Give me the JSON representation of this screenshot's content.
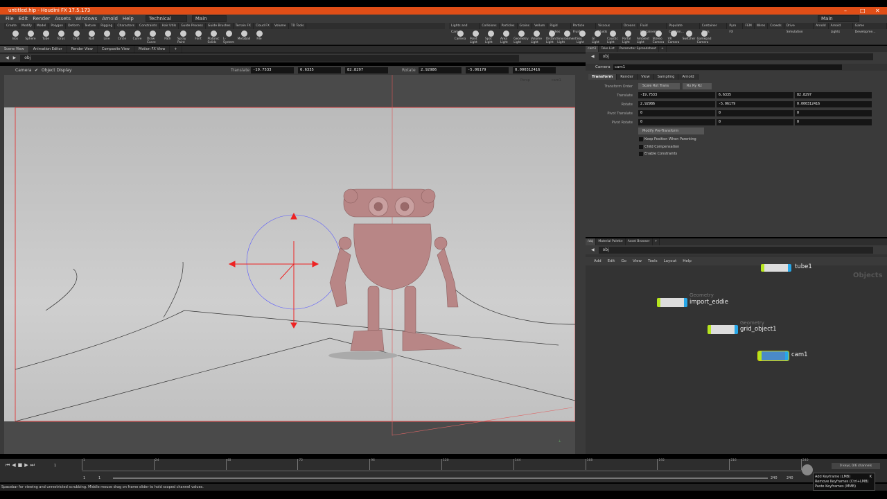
{
  "window": {
    "title": "untitled.hip - Houdini FX 17.5.173"
  },
  "menu": [
    "File",
    "Edit",
    "Render",
    "Assets",
    "Windows",
    "Arnold",
    "Help"
  ],
  "desktop": "Technical",
  "desktop2": "Main",
  "desktop_right": "Main",
  "shelf_tabs_left": [
    "Create",
    "Modify",
    "Model",
    "Polygon",
    "Deform",
    "Texture",
    "Rigging",
    "Characters",
    "Constraints",
    "Hair Utils",
    "Guide Process",
    "Guide Brushes",
    "Terrain FX",
    "Cloud FX",
    "Volume",
    "TD Tools"
  ],
  "shelf_tools_left": [
    "Box",
    "Sphere",
    "Tube",
    "Torus",
    "Grid",
    "Null",
    "Line",
    "Circle",
    "Curve",
    "Draw Curve",
    "Path",
    "Spray Paint",
    "Font",
    "Platonic Solids",
    "L-System",
    "Metaball",
    "File"
  ],
  "shelf_tabs_right": [
    "Lights and Cam...",
    "Collisions",
    "Particles",
    "Grains",
    "Vellum",
    "Rigid Bodies",
    "Particle Fluids",
    "Viscous Fluids",
    "Oceans",
    "Fluid Containers",
    "Populate Contain...",
    "Container Tools",
    "Pyro FX",
    "FEM",
    "Wires",
    "Crowds",
    "Drive Simulation",
    "Arnold",
    "Arnold Lights",
    "Game Developme..."
  ],
  "shelf_tools_right": [
    "Camera",
    "Point Light",
    "Spot Light",
    "Area Light",
    "Geometry Light",
    "Volume Light",
    "Distant Light",
    "Environment Light",
    "Sky Light",
    "GI Light",
    "Caustic Light",
    "Portal Light",
    "Ambient Light",
    "Stereo Camera",
    "VR Camera",
    "Switcher",
    "Gamepad Camera"
  ],
  "viewer": {
    "tabs": [
      "Scene View",
      "Animation Editor",
      "Render View",
      "Composite View",
      "Motion FX View"
    ],
    "path": "obj",
    "tool": "Camera",
    "object_display": "Object Display",
    "translate_label": "Translate",
    "translate": [
      "-19.7533",
      "6.6335",
      "82.8297"
    ],
    "rotate_label": "Rotate",
    "rotate": [
      "2.92986",
      "-5.06179",
      "0.000312416"
    ],
    "persp": "Persp",
    "cam": "cam1"
  },
  "params": {
    "tabs": [
      "cam1",
      "Take List",
      "Parameter Spreadsheet"
    ],
    "path": "obj",
    "node_type": "Camera",
    "node_name": "cam1",
    "subtabs": [
      "Transform",
      "Render",
      "View",
      "Sampling",
      "Arnold"
    ],
    "transform_order_label": "Transform Order",
    "transform_order": "Scale Rot Trans",
    "rot_order": "Rx Ry Rz",
    "rows": [
      {
        "label": "Translate",
        "values": [
          "-19.7533",
          "6.6335",
          "82.8297"
        ]
      },
      {
        "label": "Rotate",
        "values": [
          "2.92986",
          "-5.06179",
          "0.000312416"
        ]
      },
      {
        "label": "Pivot Translate",
        "values": [
          "0",
          "0",
          "0"
        ]
      },
      {
        "label": "Pivot Rotate",
        "values": [
          "0",
          "0",
          "0"
        ]
      }
    ],
    "modify": "Modify Pre-Transform",
    "checks": [
      "Keep Position When Parenting",
      "Child Compensation",
      "Enable Constraints"
    ]
  },
  "network": {
    "tabs": [
      "/obj",
      "Material Palette",
      "Asset Browser"
    ],
    "path": "obj",
    "menu": [
      "Add",
      "Edit",
      "Go",
      "View",
      "Tools",
      "Layout",
      "Help"
    ],
    "context": "Objects",
    "nodes": [
      {
        "type": "",
        "name": "tube1"
      },
      {
        "type": "Geometry",
        "name": "import_eddie"
      },
      {
        "type": "Geometry",
        "name": "grid_object1"
      },
      {
        "type": "",
        "name": "cam1"
      }
    ]
  },
  "timeline": {
    "frame": "1",
    "ticks": [
      "1",
      "24",
      "48",
      "72",
      "96",
      "120",
      "144",
      "168",
      "192",
      "216",
      "240"
    ],
    "start": "1",
    "start2": "1",
    "end": "240",
    "end2": "240",
    "keys": "0 keys, 0/6 channels"
  },
  "tooltip": [
    "Add Keyframe (LMB)",
    "Remove Keyframes (Ctrl+LMB)",
    "Paste Keyframes (MMB)"
  ],
  "tooltip_key": "K",
  "status": "Spacebar for viewing and unrestricted scrubbing. Middle mouse drag on frame slider to hold scoped channel values."
}
